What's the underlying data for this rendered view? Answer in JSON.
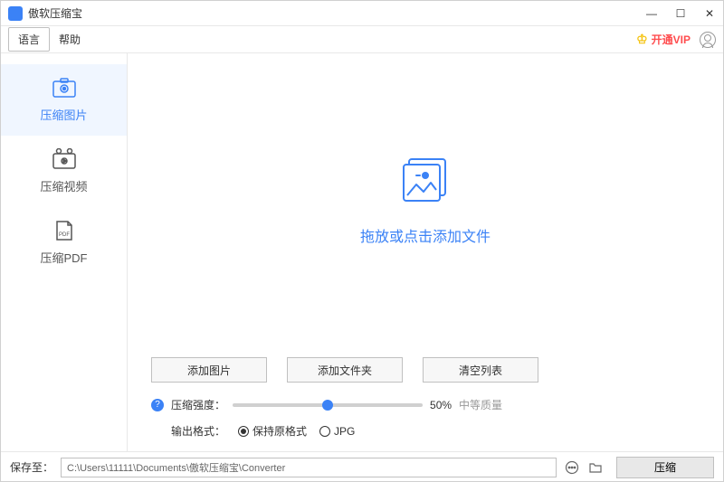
{
  "app": {
    "title": "傲软压缩宝"
  },
  "menu": {
    "language": "语言",
    "help": "帮助",
    "vip": "开通VIP"
  },
  "sidebar": {
    "items": [
      {
        "label": "压缩图片"
      },
      {
        "label": "压缩视频"
      },
      {
        "label": "压缩PDF"
      }
    ]
  },
  "main": {
    "drop_text": "拖放或点击添加文件",
    "buttons": {
      "add_image": "添加图片",
      "add_folder": "添加文件夹",
      "clear_list": "清空列表"
    },
    "strength_label": "压缩强度：",
    "strength_value": "50%",
    "quality_label": "中等质量",
    "format_label": "输出格式：",
    "format_keep": "保持原格式",
    "format_jpg": "JPG"
  },
  "footer": {
    "save_to": "保存至：",
    "path": "C:\\Users\\11111\\Documents\\傲软压缩宝\\Converter",
    "compress": "压缩"
  }
}
